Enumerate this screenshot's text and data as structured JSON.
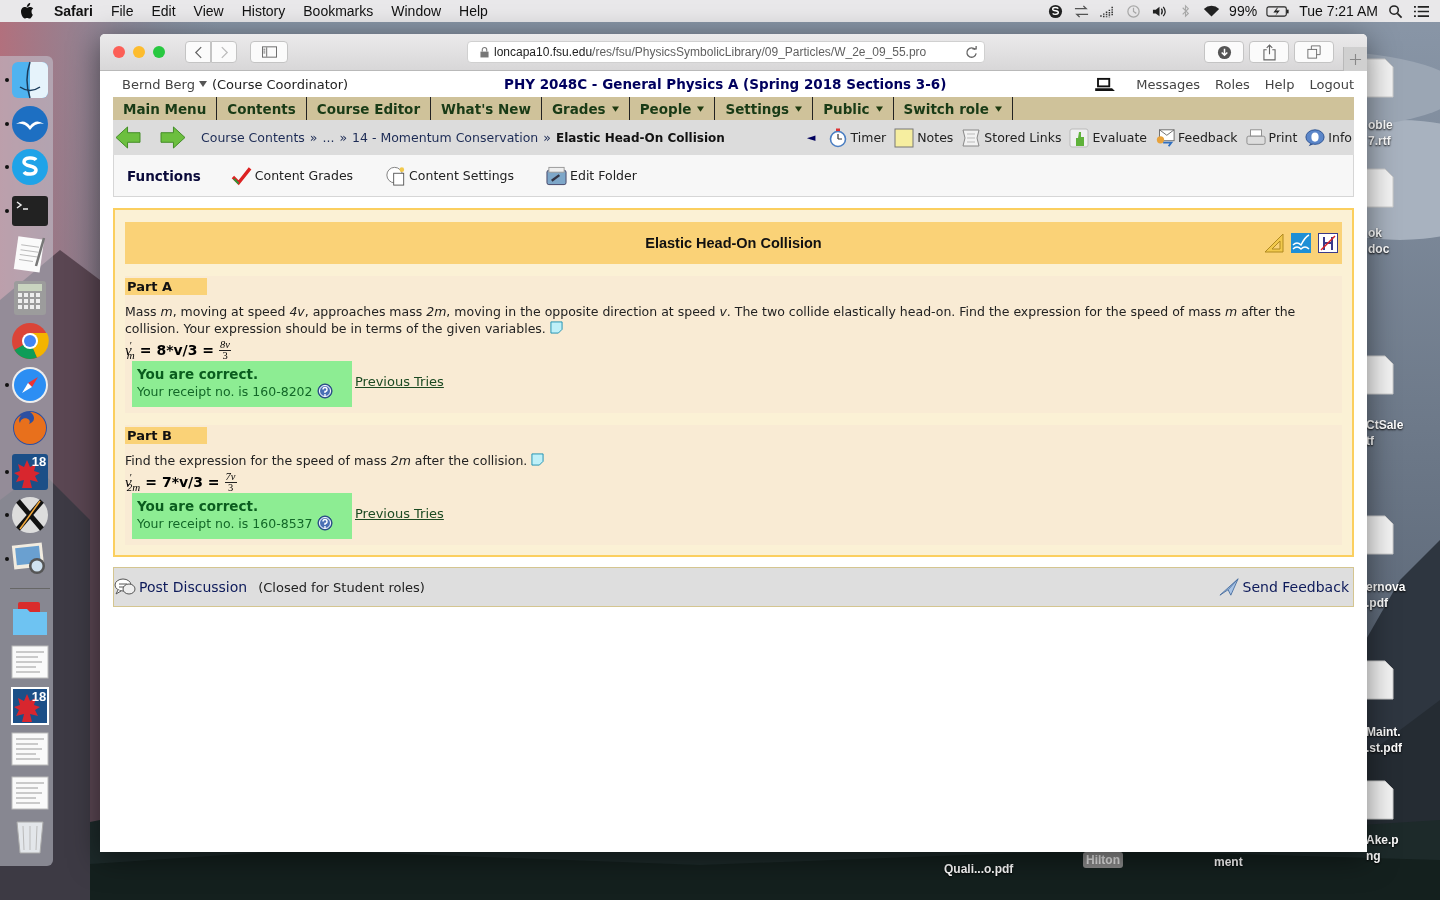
{
  "menu_bar": {
    "app": "Safari",
    "menus": [
      "File",
      "Edit",
      "View",
      "History",
      "Bookmarks",
      "Window",
      "Help"
    ],
    "battery": "99%",
    "clock": "Tue 7:21 AM"
  },
  "dock": {
    "apps": [
      {
        "kind": "finder",
        "running": true
      },
      {
        "kind": "gulls",
        "running": true
      },
      {
        "kind": "skype",
        "running": true
      },
      {
        "kind": "terminal",
        "running": true
      },
      {
        "kind": "textedit",
        "running": false
      },
      {
        "kind": "calculator",
        "running": false
      },
      {
        "kind": "chrome",
        "running": false
      },
      {
        "kind": "safari",
        "running": true
      },
      {
        "kind": "firefox",
        "running": false
      },
      {
        "kind": "maple",
        "running": true,
        "badge": "18"
      },
      {
        "kind": "x11",
        "running": true
      },
      {
        "kind": "preview",
        "running": true
      }
    ],
    "stacks": [
      {
        "kind": "folder"
      },
      {
        "kind": "document"
      },
      {
        "kind": "maple",
        "badge": "18"
      },
      {
        "kind": "document"
      },
      {
        "kind": "document"
      },
      {
        "kind": "trash"
      }
    ]
  },
  "desktop_files": [
    {
      "lines": [
        "oble",
        "7.rtf"
      ]
    },
    {
      "lines": [
        "ok",
        "doc"
      ]
    },
    {
      "lines": [
        "CtSale",
        "tf"
      ]
    },
    {
      "lines": [
        "ernova",
        ".pdf"
      ]
    },
    {
      "lines": [
        "Maint.",
        ".st.pdf"
      ]
    },
    {
      "lines": [
        "Ake.p",
        "ng"
      ]
    },
    {
      "lines": [
        "Quali...o.pdf"
      ]
    },
    {
      "lines": [
        "Hilton"
      ],
      "kind": "tag"
    },
    {
      "lines": [
        "ment"
      ]
    }
  ],
  "browser": {
    "url_host": "loncapa10.fsu.edu",
    "url_path": "/res/fsu/PhysicsSymbolicLibrary/09_Particles/W_2e_09_55.pro"
  },
  "header": {
    "user": "Bernd Berg",
    "role": "(Course Coordinator)",
    "course": "PHY 2048C - General Physics A (Spring 2018 Sections 3-6)",
    "links": [
      "Messages",
      "Roles",
      "Help",
      "Logout"
    ]
  },
  "main_menu": [
    {
      "label": "Main Menu",
      "dropdown": false
    },
    {
      "label": "Contents",
      "dropdown": false
    },
    {
      "label": "Course Editor",
      "dropdown": false
    },
    {
      "label": "What's New",
      "dropdown": false
    },
    {
      "label": "Grades",
      "dropdown": true
    },
    {
      "label": "People",
      "dropdown": true
    },
    {
      "label": "Settings",
      "dropdown": true
    },
    {
      "label": "Public",
      "dropdown": true
    },
    {
      "label": "Switch role",
      "dropdown": true
    }
  ],
  "breadcrumbs": [
    {
      "kind": "link",
      "text": "Course Contents",
      "current": false
    },
    {
      "kind": "sep",
      "text": "»"
    },
    {
      "kind": "link",
      "text": "...",
      "current": false
    },
    {
      "kind": "sep",
      "text": "»"
    },
    {
      "kind": "link",
      "text": "14 - Momentum Conservation",
      "current": false
    },
    {
      "kind": "sep",
      "text": "»"
    },
    {
      "kind": "link",
      "text": "Elastic Head-On Collision",
      "current": true
    }
  ],
  "tools_toggle": "◄",
  "tools": [
    {
      "kind": "timer",
      "label": "Timer"
    },
    {
      "kind": "notes",
      "label": "Notes"
    },
    {
      "kind": "links",
      "label": "Stored Links"
    },
    {
      "kind": "evaluate",
      "label": "Evaluate"
    },
    {
      "kind": "feedback",
      "label": "Feedback"
    },
    {
      "kind": "print",
      "label": "Print"
    },
    {
      "kind": "info",
      "label": "Info"
    }
  ],
  "functions": {
    "title": "Functions",
    "items": [
      {
        "kind": "grades",
        "label": "Content Grades"
      },
      {
        "kind": "settings",
        "label": "Content Settings"
      },
      {
        "kind": "folder",
        "label": "Edit Folder"
      }
    ]
  },
  "problem": {
    "title": "Elastic Head-On Collision",
    "parts": [
      {
        "title": "Part A",
        "text": "Mass *m*, moving at speed *4v*, approaches mass *2m*, moving in the opposite direction at speed *v*. The two collide elastically head-on. Find the expression for the speed of mass *m* after the collision. Your expression should be in terms of the given variables.",
        "symbol": "*v*$^{′}$$_{m}$",
        "answer": "= 8*v/3 =",
        "fraction": {
          "num": "*8v*",
          "den": "3"
        },
        "correct": true,
        "feedback": "You are correct.",
        "receipt": "Your receipt no. is 160-8202",
        "previous": "Previous Tries"
      },
      {
        "title": "Part B",
        "text": "Find the expression for the speed of mass *2m* after the collision.",
        "symbol": "*v*$^{′}$$_{2m}$",
        "answer": "= 7*v/3 =",
        "fraction": {
          "num": "*7v*",
          "den": "3"
        },
        "correct": true,
        "feedback": "You are correct.",
        "receipt": "Your receipt no. is 160-8537",
        "previous": "Previous Tries"
      }
    ]
  },
  "discussion": {
    "post": "Post Discussion",
    "note": "(Closed for Student roles)",
    "send": "Send Feedback"
  }
}
